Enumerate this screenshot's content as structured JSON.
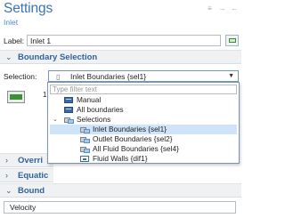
{
  "header": {
    "title": "Settings",
    "subtitle": "Inlet",
    "controls": [
      "≡",
      "→",
      "←"
    ]
  },
  "label_field": {
    "label": "Label:",
    "value": "Inlet 1"
  },
  "boundary_section": {
    "title": "Boundary Selection"
  },
  "selection": {
    "label": "Selection:",
    "value": "Inlet Boundaries {sel1}",
    "list_number": "1"
  },
  "dropdown": {
    "filter_placeholder": "Type filter text",
    "items": [
      {
        "label": "Manual",
        "icon": "box-icon",
        "level": 0
      },
      {
        "label": "All boundaries",
        "icon": "box-icon",
        "level": 0
      },
      {
        "label": "Selections",
        "icon": "selection-icon",
        "level": 0,
        "expanded": true
      },
      {
        "label": "Inlet Boundaries {sel1}",
        "icon": "selection-icon",
        "level": 1,
        "selected": true
      },
      {
        "label": "Outlet Boundaries {sel2}",
        "icon": "selection-icon",
        "level": 1
      },
      {
        "label": "All Fluid Boundaries {sel4}",
        "icon": "selection-icon",
        "level": 1
      },
      {
        "label": "Fluid Walls {dif1}",
        "icon": "fluid-icon",
        "level": 1
      }
    ]
  },
  "collapsed_sections": [
    {
      "label": "Overri"
    },
    {
      "label": "Equatic"
    },
    {
      "label": "Bound"
    }
  ],
  "velocity": {
    "value": "Velocity"
  }
}
